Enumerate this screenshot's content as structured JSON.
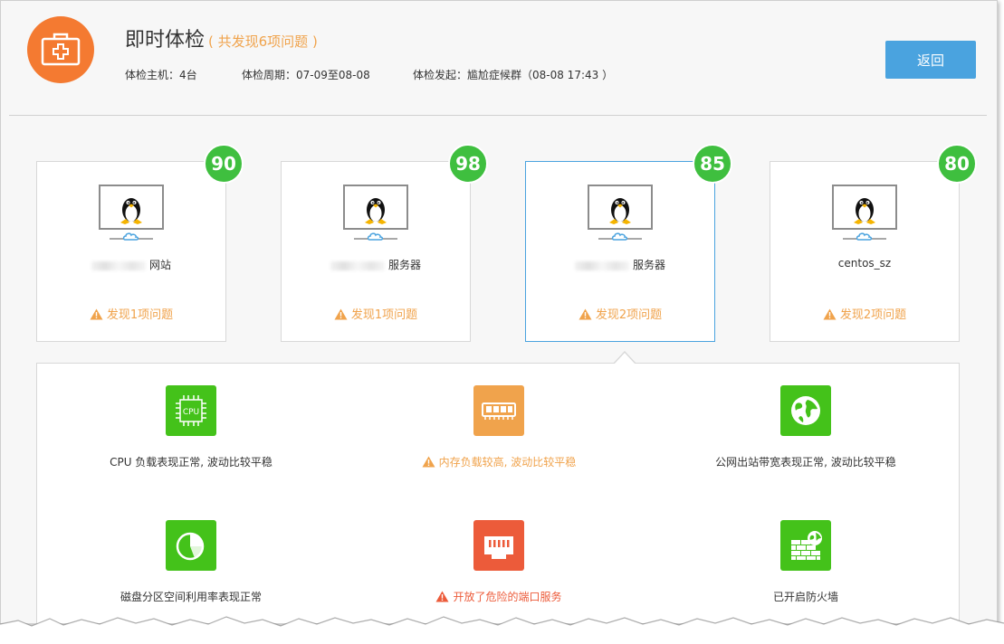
{
  "header": {
    "title": "即时体检",
    "subtitle": "( 共发现6项问题 )",
    "hosts_meta": "体检主机：4台",
    "period_meta": "体检周期：07-09至08-08",
    "initiator_meta": "体检发起：尴尬症候群（08-08 17:43 ）",
    "back_label": "返回",
    "logo_icon": "medical-kit-icon"
  },
  "hosts": [
    {
      "score": "90",
      "name": "网站",
      "issue": "发现1项问题",
      "active": false
    },
    {
      "score": "98",
      "name": "服务器",
      "issue": "发现1项问题",
      "active": false
    },
    {
      "score": "85",
      "name": "服务器",
      "issue": "发现2项问题",
      "active": true
    },
    {
      "score": "80",
      "name": "centos_sz",
      "issue": "发现2项问题",
      "active": false
    }
  ],
  "checks": [
    {
      "icon": "cpu-icon",
      "text": "CPU 负载表现正常, 波动比较平稳",
      "status": "ok"
    },
    {
      "icon": "memory-icon",
      "text": "内存负载较高, 波动比较平稳",
      "status": "warn"
    },
    {
      "icon": "globe-icon",
      "text": "公网出站带宽表现正常, 波动比较平稳",
      "status": "ok"
    },
    {
      "icon": "pie-chart-icon",
      "text": "磁盘分区空间利用率表现正常",
      "status": "ok"
    },
    {
      "icon": "network-port-icon",
      "text": "开放了危险的端口服务",
      "status": "danger"
    },
    {
      "icon": "firewall-icon",
      "text": "已开启防火墙",
      "status": "ok"
    }
  ],
  "cpu_chip_text": "CPU",
  "colors": {
    "accent_blue": "#4aa3df",
    "logo_orange": "#f47a31",
    "score_green": "#3fbf3f",
    "warning": "#f0a34c",
    "danger": "#ec5b3a",
    "ok_tile": "#44c21a"
  }
}
